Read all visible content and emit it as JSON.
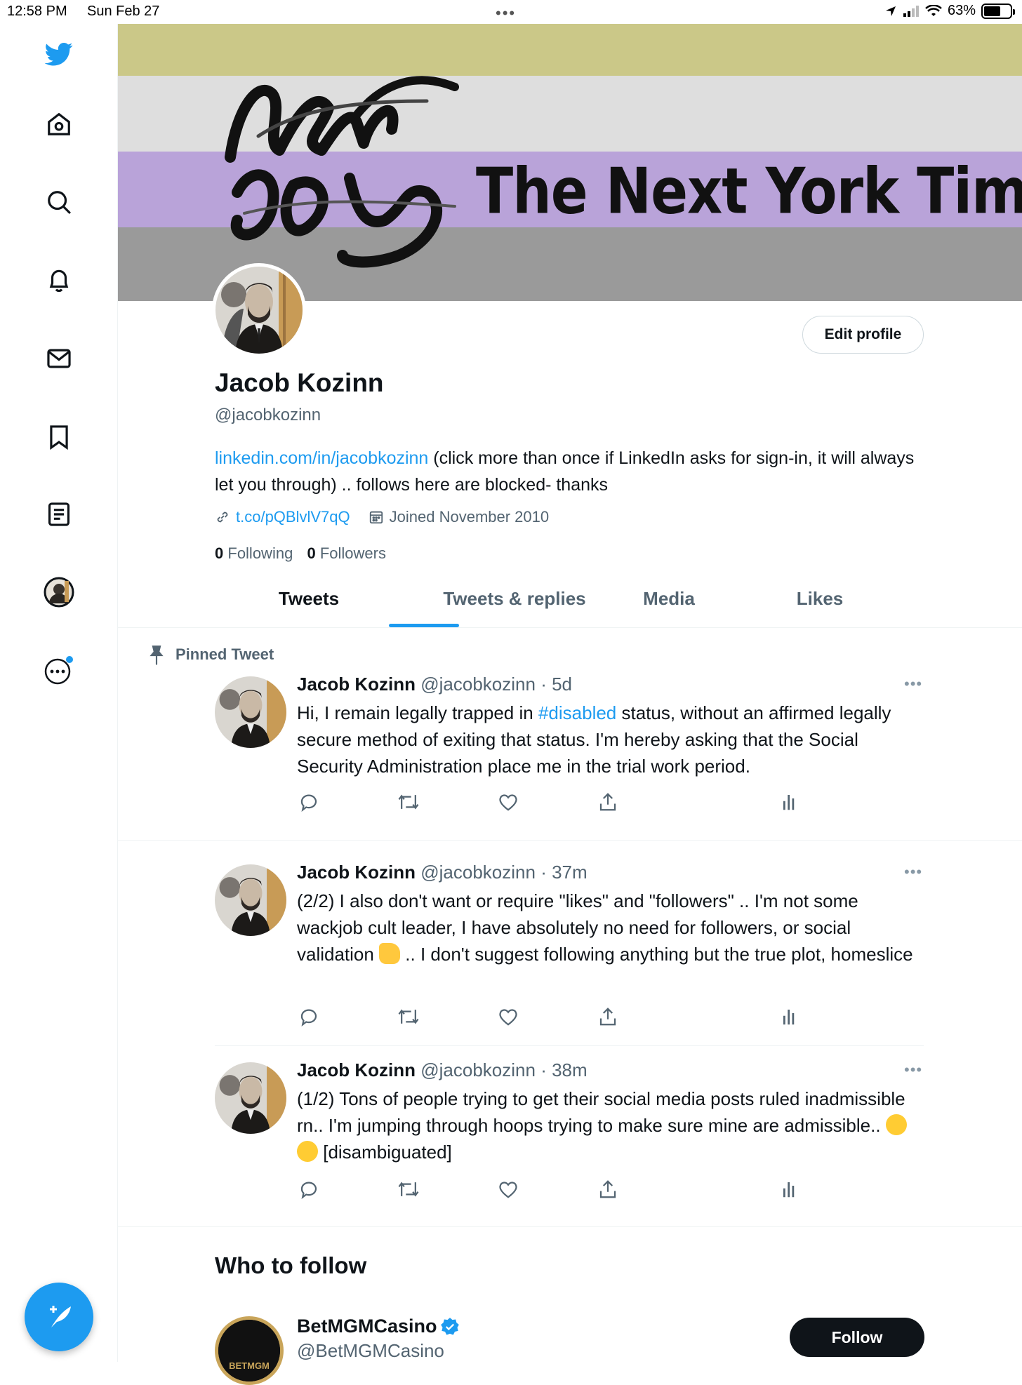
{
  "status_bar": {
    "time": "12:58 PM",
    "date": "Sun Feb 27",
    "battery": "63%",
    "battery_level": 0.63
  },
  "sidebar": {
    "items": [
      {
        "icon": "twitter-bird-icon"
      },
      {
        "icon": "home-icon"
      },
      {
        "icon": "search-icon"
      },
      {
        "icon": "bell-icon"
      },
      {
        "icon": "mail-icon"
      },
      {
        "icon": "bookmark-icon"
      },
      {
        "icon": "lists-icon"
      },
      {
        "icon": "profile-avatar-icon"
      },
      {
        "icon": "more-circle-icon"
      }
    ],
    "compose_icon": "compose-tweet-icon"
  },
  "banner": {
    "title": "The Next York Times",
    "logo_text": "Next York"
  },
  "profile": {
    "name": "Jacob Kozinn",
    "handle": "@jacobkozinn",
    "edit_label": "Edit profile",
    "bio_link": "linkedin.com/in/jacobkozinn",
    "bio_rest": " (click more than once if LinkedIn asks for sign-in, it will always let you through) .. follows here are blocked- thanks",
    "url": "t.co/pQBlvlV7qQ",
    "joined": "Joined November 2010",
    "following_count": "0",
    "following_label": "Following",
    "followers_count": "0",
    "followers_label": "Followers"
  },
  "tabs": [
    "Tweets",
    "Tweets & replies",
    "Media",
    "Likes"
  ],
  "pinned_label": "Pinned Tweet",
  "tweets": [
    {
      "name": "Jacob Kozinn",
      "handle": "@jacobkozinn",
      "time": "5d",
      "text_before": "Hi, I remain legally trapped in ",
      "hashtag": "#disabled",
      "text_after": " status, without an affirmed legally secure method of exiting that status. I'm hereby asking that the Social Security Administration place me in the trial work period."
    },
    {
      "name": "Jacob Kozinn",
      "handle": "@jacobkozinn",
      "time": "37m",
      "text_before": "(2/2) I also don't want or require \"likes\" and \"followers\" .. I'm not some wackjob cult leader, I have absolutely no need for followers, or social validation ",
      "emoji1": "thumbs-up-emoji",
      "text_after": " .. I don't suggest following anything but the true plot, homeslice"
    },
    {
      "name": "Jacob Kozinn",
      "handle": "@jacobkozinn",
      "time": "38m",
      "text_before": "(1/2) Tons of people trying to get their social media posts ruled inadmissible rn.. I'm jumping through hoops trying to make sure mine are admissible.. ",
      "emoji1": "tears-of-joy-emoji",
      "emoji2": "rolling-laughing-emoji",
      "text_after": " [disambiguated]"
    }
  ],
  "who_to_follow": {
    "title": "Who to follow",
    "name": "BetMGMCasino",
    "handle": "@BetMGMCasino",
    "avatar_text": "BETMGM",
    "follow_label": "Follow"
  },
  "colors": {
    "accent": "#1d9bf0",
    "banner_yellow": "#cbc888",
    "banner_lightgray": "#dedede",
    "banner_lavender": "#b9a3d9",
    "banner_gray": "#9a9a9a"
  }
}
